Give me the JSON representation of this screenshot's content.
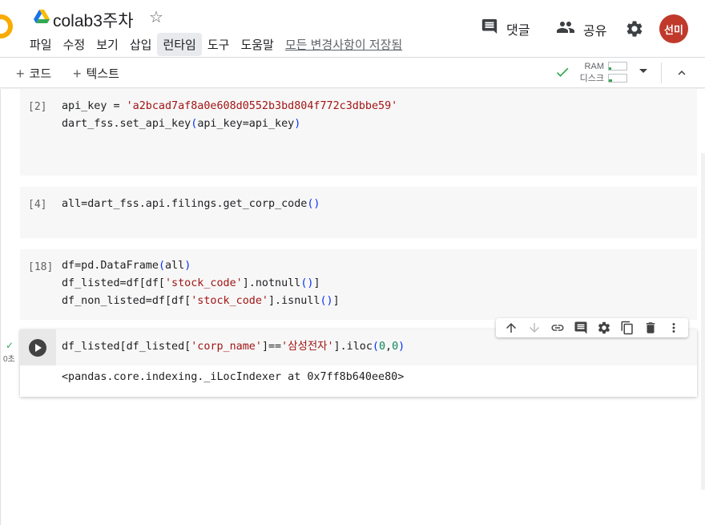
{
  "document": {
    "title": "colab3주차"
  },
  "menu": {
    "items": [
      "파일",
      "수정",
      "보기",
      "삽입",
      "런타임",
      "도구",
      "도움말"
    ],
    "active": "런타임",
    "saved_note": "모든 변경사항이 저장됨"
  },
  "header_actions": {
    "comment_label": "댓글",
    "share_label": "공유",
    "avatar_initials": "선미"
  },
  "toolbar": {
    "add_code_label": "코드",
    "add_text_label": "텍스트",
    "ram_label": "RAM",
    "disk_label": "디스크",
    "ram_usage": 0.15,
    "disk_usage": 0.2
  },
  "cells": [
    {
      "exec_count": "[2]",
      "lines": [
        "api_key = 'a2bcad7af8a0e608d0552b3bd804f772c3dbbe59'",
        "dart_fss.set_api_key(api_key=api_key)"
      ]
    },
    {
      "exec_count": "[4]",
      "lines": [
        "all=dart_fss.api.filings.get_corp_code()"
      ]
    },
    {
      "exec_count": "[18]",
      "lines": [
        "df=pd.DataFrame(all)",
        "df_listed=df[df['stock_code'].notnull()]",
        "df_non_listed=df[df['stock_code'].isnull()]"
      ]
    }
  ],
  "active_cell": {
    "code": "df_listed[df_listed['corp_name']=='삼성전자'].iloc(0,0)",
    "output": "<pandas.core.indexing._iLocIndexer at 0x7ff8b640ee80>",
    "exec_time": "0초"
  },
  "colors": {
    "accent": "#f9ab00",
    "avatar": "#c0392b",
    "string": "#a31515",
    "paren": "#0431fa",
    "number": "#098658",
    "check": "#34a853"
  },
  "icons": {
    "cell_toolbar": [
      "arrow-up-icon",
      "arrow-down-icon",
      "link-icon",
      "comment-icon",
      "gear-icon",
      "mirror-icon",
      "trash-icon",
      "more-vert-icon"
    ]
  }
}
